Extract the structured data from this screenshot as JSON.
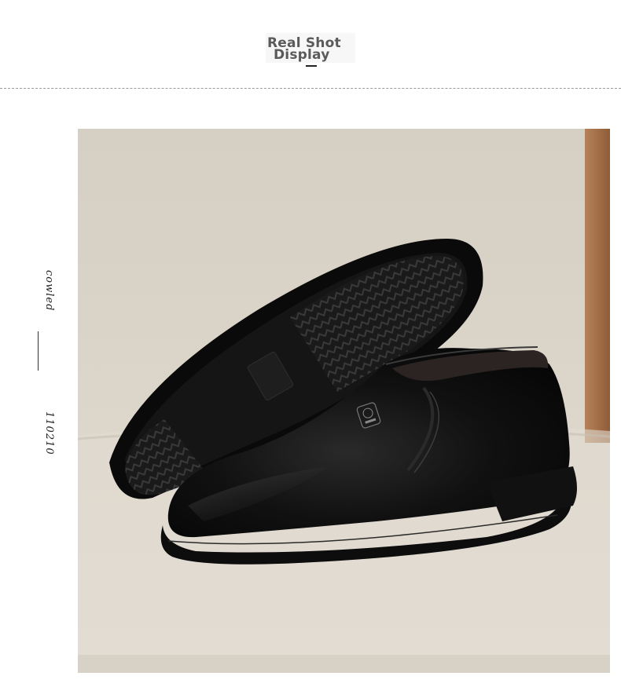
{
  "header": {
    "title_line1": "Real Shot",
    "title_line2": "Display"
  },
  "side_labels": {
    "top": "cowled",
    "bottom": "110210"
  },
  "photo": {
    "subject": "shoe-photo"
  },
  "colors": {
    "leather": "#0c0c0c",
    "chair_fabric": "#d9d2c6",
    "wood": "#a9714a"
  }
}
